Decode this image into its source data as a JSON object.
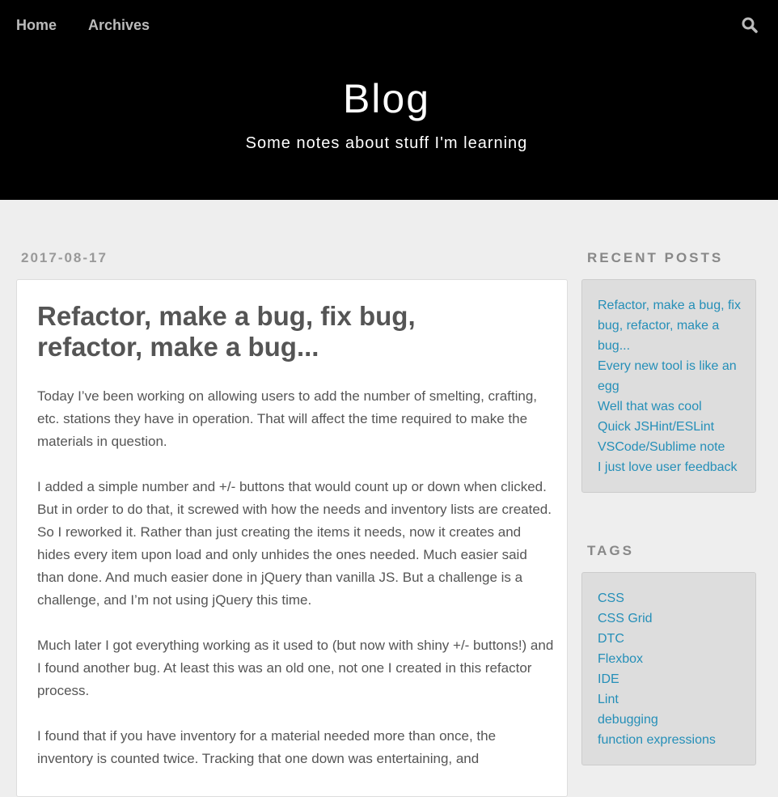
{
  "nav": {
    "home": "Home",
    "archives": "Archives",
    "search_icon": "search-icon"
  },
  "header": {
    "title": "Blog",
    "subtitle": "Some notes about stuff I'm learning"
  },
  "post": {
    "date": "2017-08-17",
    "title": "Refactor, make a bug, fix bug, refactor, make a bug...",
    "paragraphs": [
      "Today I’ve been working on allowing users to add the number of smelting, crafting, etc. stations they have in operation. That will affect the time required to make the materials in question.",
      "I added a simple number and +/- buttons that would count up or down when clicked. But in order to do that, it screwed with how the needs and inventory lists are created. So I reworked it. Rather than just creating the items it needs, now it creates and hides every item upon load and only unhides the ones needed. Much easier said than done. And much easier done in jQuery than vanilla JS. But a challenge is a challenge, and I’m not using jQuery this time.",
      "Much later I got everything working as it used to (but now with shiny +/- buttons!) and I found another bug. At least this was an old one, not one I created in this refactor process.",
      "I found that if you have inventory for a material needed more than once, the inventory is counted twice. Tracking that one down was entertaining, and"
    ]
  },
  "sidebar": {
    "recent_title": "Recent Posts",
    "recent_posts": [
      "Refactor, make a bug, fix bug, refactor, make a bug...",
      "Every new tool is like an egg",
      "Well that was cool",
      "Quick JSHint/ESLint VSCode/Sublime note",
      "I just love user feedback"
    ],
    "tags_title": "Tags",
    "tags": [
      "CSS",
      "CSS Grid",
      "DTC",
      "Flexbox",
      "IDE",
      "Lint",
      "debugging",
      "function expressions"
    ]
  },
  "colors": {
    "header_bg": "#000000",
    "page_bg": "#eeeeee",
    "link": "#258fb8",
    "text": "#555555"
  }
}
